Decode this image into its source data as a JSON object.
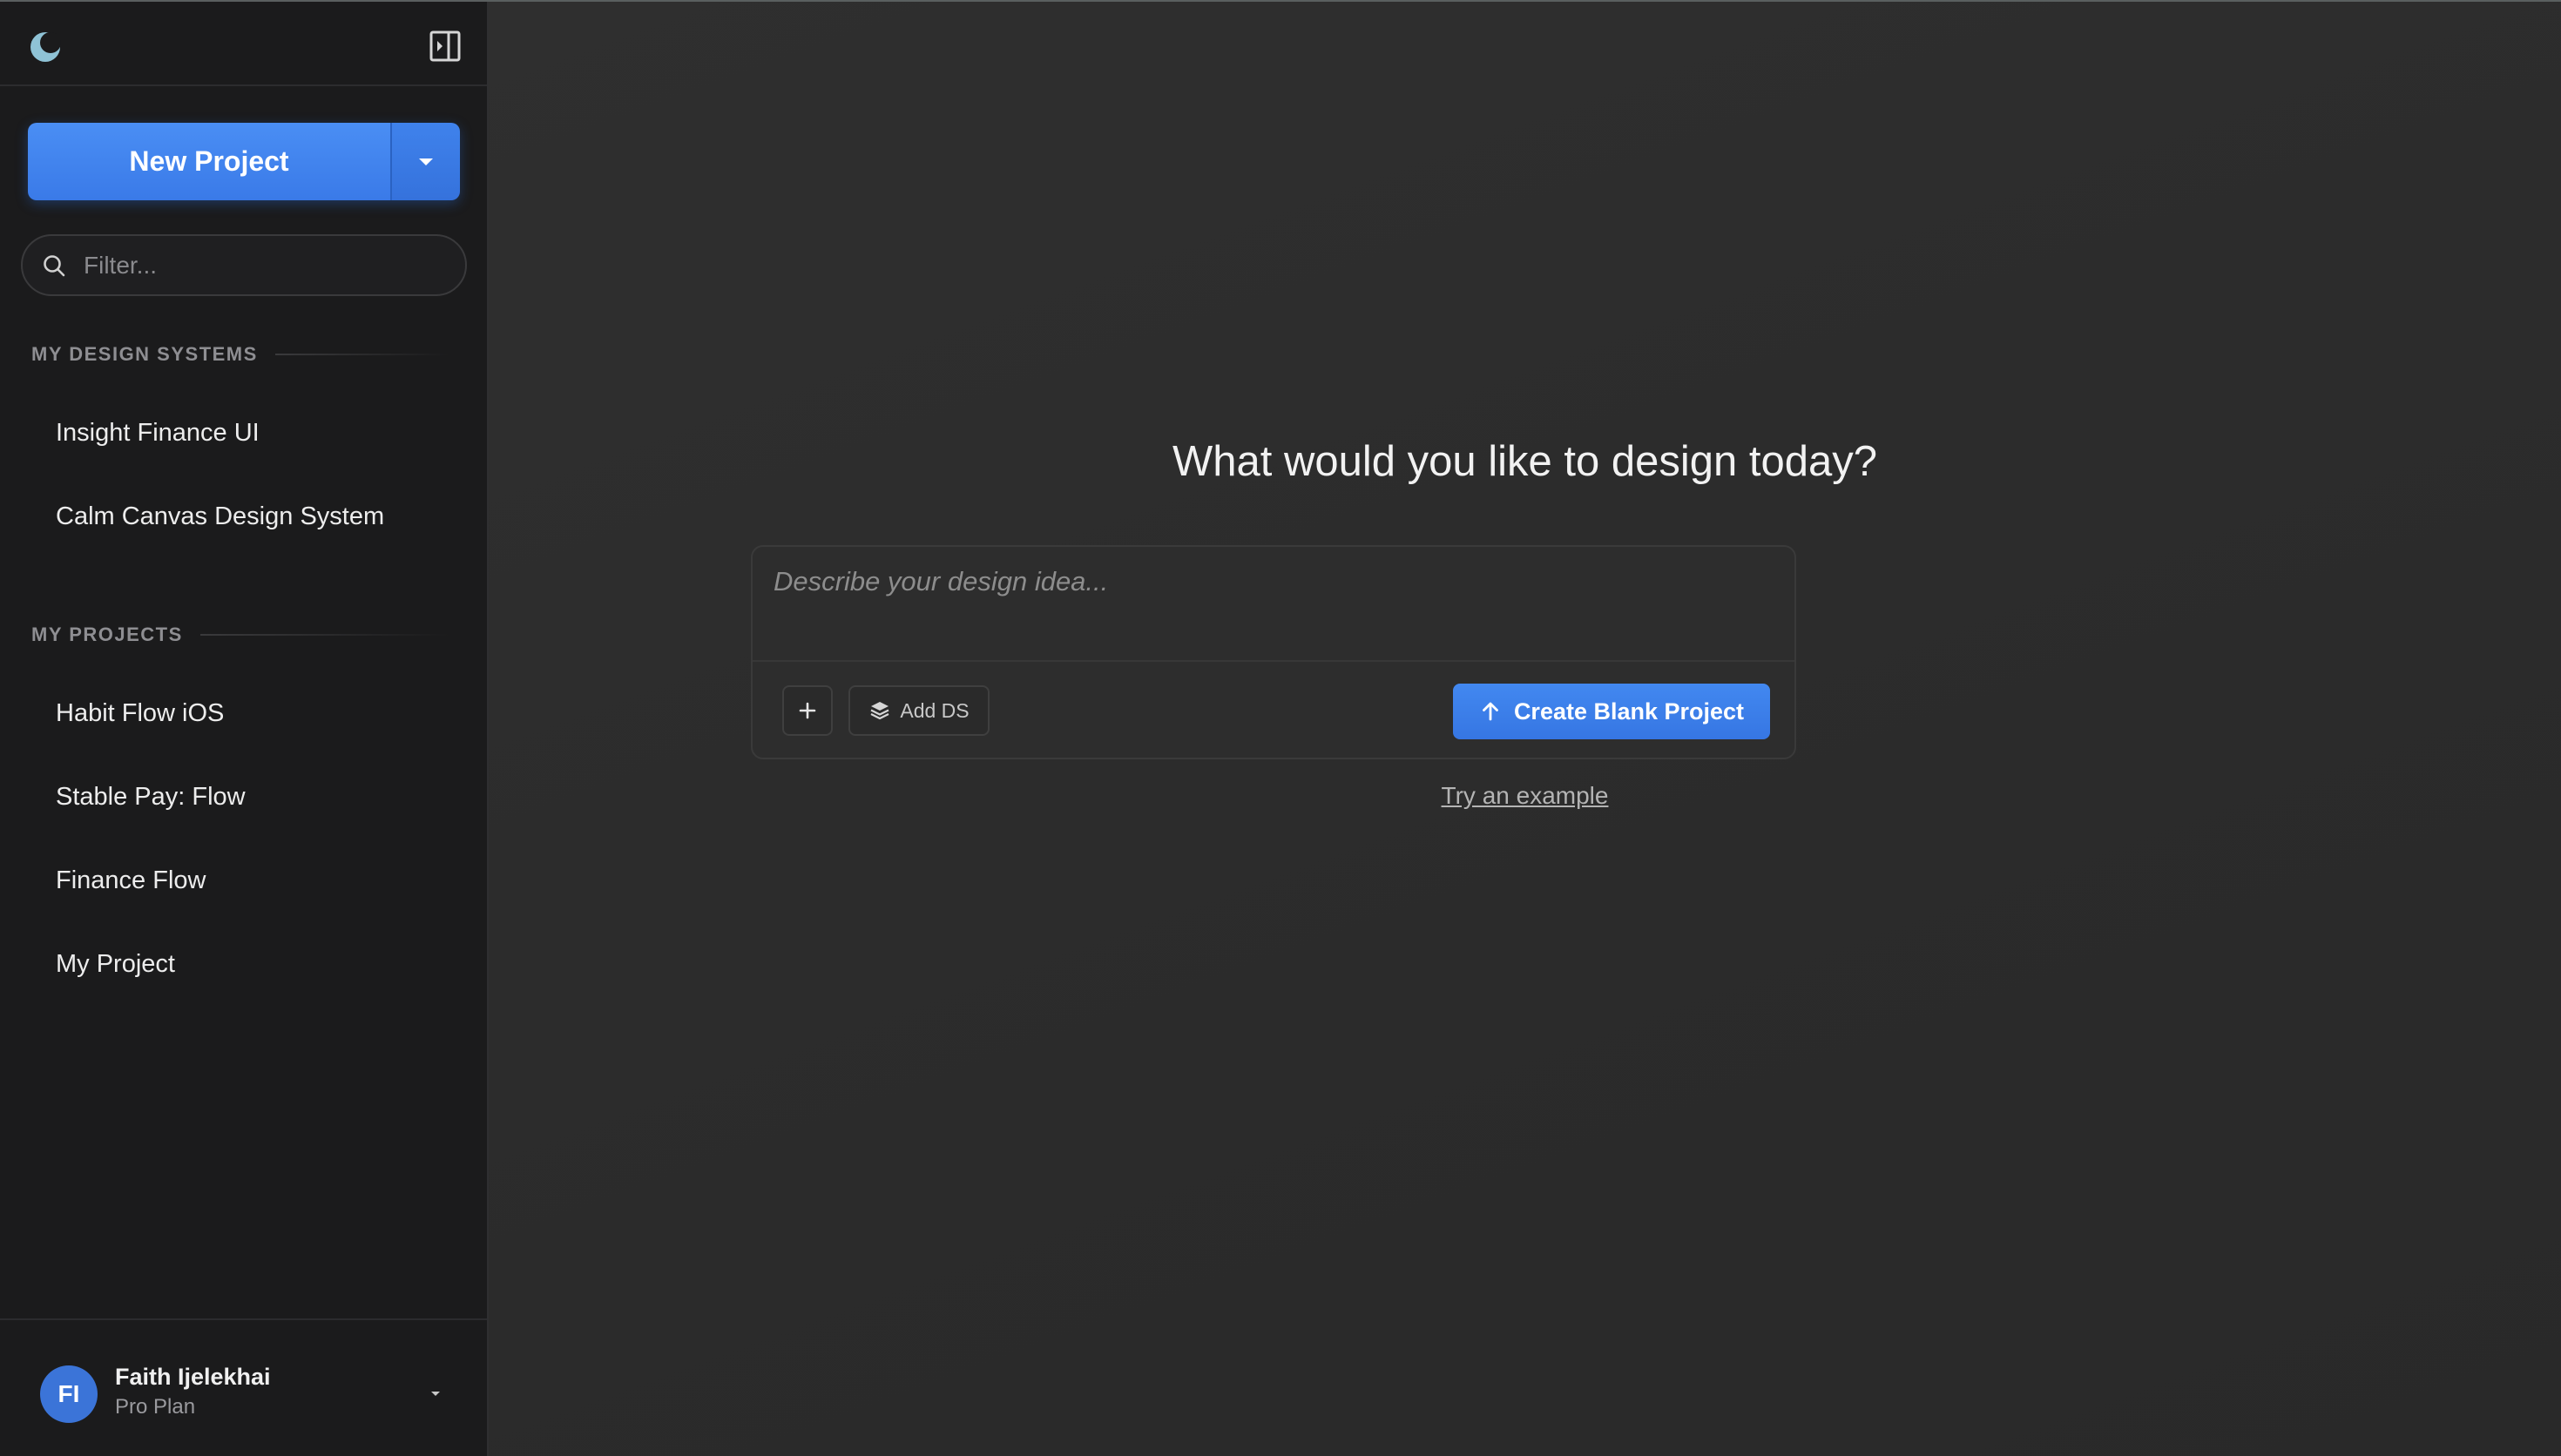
{
  "sidebar": {
    "new_project_label": "New Project",
    "filter_placeholder": "Filter...",
    "design_systems_heading": "MY DESIGN SYSTEMS",
    "design_systems": [
      {
        "label": "Insight Finance UI"
      },
      {
        "label": "Calm Canvas Design System"
      }
    ],
    "projects_heading": "MY PROJECTS",
    "projects": [
      {
        "label": "Habit Flow iOS"
      },
      {
        "label": "Stable Pay: Flow"
      },
      {
        "label": "Finance Flow"
      },
      {
        "label": "My Project"
      }
    ],
    "user": {
      "initials": "FI",
      "name": "Faith Ijelekhai",
      "plan": "Pro Plan"
    }
  },
  "main": {
    "headline": "What would you like to design today?",
    "prompt_placeholder": "Describe your design idea...",
    "add_ds_label": "Add DS",
    "create_label": "Create Blank Project",
    "try_example_label": "Try an example"
  },
  "colors": {
    "accent": "#3f82ec",
    "sidebar_bg": "#1b1b1c",
    "main_bg": "#2c2c2c",
    "logo": "#8fc3d6"
  },
  "icons": {
    "logo": "moon-logo-icon",
    "collapse": "sidebar-toggle-icon",
    "dropdown": "caret-down-icon",
    "search": "search-icon",
    "plus": "plus-icon",
    "layers": "layers-icon",
    "arrow_up": "arrow-up-icon"
  }
}
